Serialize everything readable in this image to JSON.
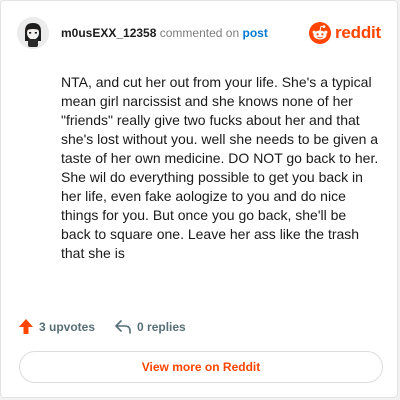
{
  "header": {
    "username": "m0usEXX_12358",
    "action_text": "commented on",
    "post_link": "post",
    "brand": "reddit"
  },
  "comment": {
    "body": "NTA, and cut her out from your life. She's a typical mean girl narcissist and she knows none of her \"friends\" really give two fucks about her and that she's lost without you. well she needs to be given a taste of her own medicine. DO NOT go back to her. She wil do everything possible to get you back in her life, even fake aologize to you and do nice things for you. But once you go back, she'll be back to square one. Leave her ass like the trash that she is"
  },
  "footer": {
    "upvotes": "3 upvotes",
    "replies": "0 replies"
  },
  "cta": {
    "label": "View more on Reddit"
  },
  "icons": {
    "upvote": "upvote-arrow-icon",
    "reply": "reply-arrow-icon",
    "brand": "reddit-snoo-icon"
  },
  "colors": {
    "brand": "#ff4500",
    "link": "#0079d3",
    "meta": "#576f76"
  }
}
